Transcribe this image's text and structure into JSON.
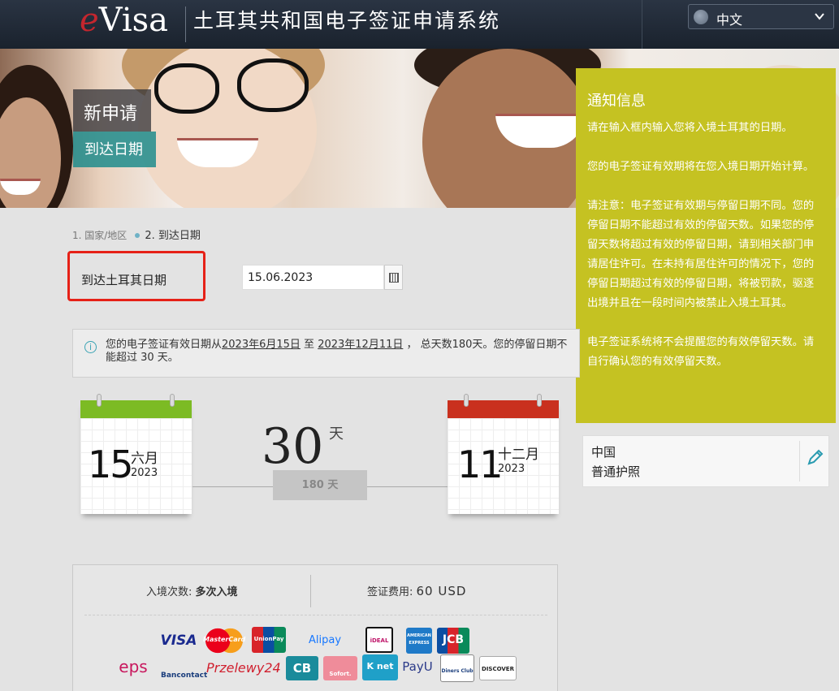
{
  "header": {
    "logo_e": "e",
    "logo_rest": "Visa",
    "title": "土耳其共和国电子签证申请系统",
    "language": {
      "selected": "中文",
      "icon": "globe-icon"
    }
  },
  "banner": {
    "stage_title": "新申请",
    "stage_sub": "到达日期"
  },
  "breadcrumb": {
    "step1": "1. 国家/地区",
    "step2": "2. 到达日期"
  },
  "form": {
    "arrival_label": "到达土耳其日期",
    "arrival_value": "15.06.2023"
  },
  "info": {
    "part1": "您的电子签证有效日期从",
    "start_date": "2023年6月15日",
    "part2": " 至 ",
    "end_date": "2023年12月11日",
    "part3": " ， 总天数180天。您的停留日期不能超过 30 天。"
  },
  "validity": {
    "start": {
      "day": "15",
      "month": "六月",
      "year": "2023"
    },
    "end": {
      "day": "11",
      "month": "十二月",
      "year": "2023"
    },
    "stay_days": "30",
    "stay_unit": "天",
    "total_label": "180 天"
  },
  "payment": {
    "entries_label": "入境次数: ",
    "entries_value": "多次入境",
    "fee_label": "签证费用: ",
    "fee_value": "60 USD",
    "logos": [
      "VISA",
      "MasterCard",
      "UnionPay",
      "Alipay",
      "iDEAL",
      "AMERICAN EXPRESS",
      "JCB",
      "eps",
      "Bancontact",
      "Przelewy24",
      "CB",
      "Sofort.",
      "K net",
      "PayU",
      "Diners Club",
      "DISCOVER"
    ]
  },
  "notice": {
    "title": "通知信息",
    "p1": "请在输入框内输入您将入境土耳其的日期。",
    "p2": "您的电子签证有效期将在您入境日期开始计算。",
    "p3": "请注意：电子签证有效期与停留日期不同。您的停留日期不能超过有效的停留天数。如果您的停留天数将超过有效的停留日期，请到相关部门申请居住许可。在未持有居住许可的情况下，您的停留日期超过有效的停留日期，将被罚款，驱逐出境并且在一段时间内被禁止入境土耳其。",
    "p4": "电子签证系统将不会提醒您的有效停留天数。请自行确认您的有效停留天数。"
  },
  "summary": {
    "country": "中国",
    "passport_type": "普通护照",
    "edit_icon": "pencil-icon"
  },
  "colors": {
    "notice_bg": "#c5c222",
    "highlight_border": "#e62117",
    "start_calendar": "#7cbb24",
    "end_calendar": "#c9301e",
    "stage_sub_bg": "#208c8c"
  }
}
